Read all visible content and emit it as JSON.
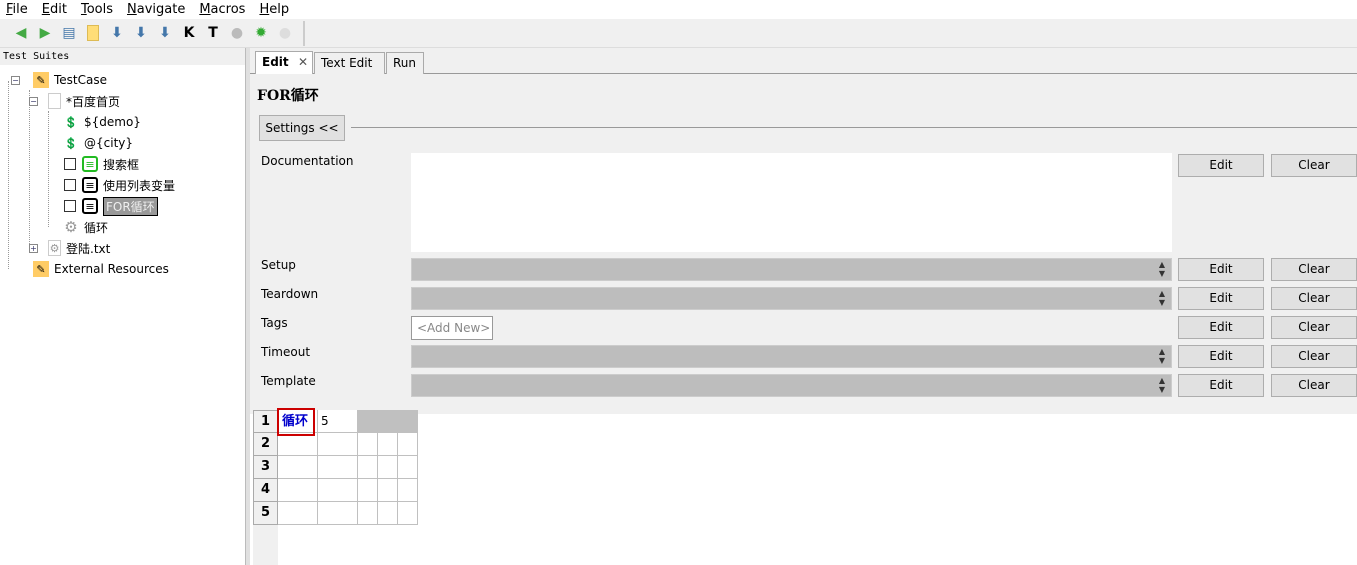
{
  "menu": [
    "File",
    "Edit",
    "Tools",
    "Navigate",
    "Macros",
    "Help"
  ],
  "toolbar": [
    "back-icon",
    "forward-icon",
    "open-icon",
    "folder-icon",
    "save-icon",
    "save-all-icon",
    "save-as-icon",
    "K",
    "T",
    "run-icon",
    "debug-icon",
    "stop-icon"
  ],
  "tree": {
    "header": "Test Suites",
    "nodes": [
      {
        "label": "TestCase",
        "icon": "suite-icon"
      },
      {
        "label": "*百度首页",
        "icon": "file-icon"
      },
      {
        "label": "${demo}",
        "icon": "variable-icon"
      },
      {
        "label": "@{city}",
        "icon": "variable-icon"
      },
      {
        "label": "搜索框",
        "icon": "testcase-icon"
      },
      {
        "label": "使用列表变量",
        "icon": "testcase-icon"
      },
      {
        "label": "FOR循环",
        "icon": "testcase-icon",
        "selected": true
      },
      {
        "label": "循环",
        "icon": "keyword-gear-icon"
      },
      {
        "label": "登陆.txt",
        "icon": "resource-file-icon"
      },
      {
        "label": "External Resources",
        "icon": "suite-icon"
      }
    ]
  },
  "tabs": [
    {
      "label": "Edit",
      "active": true
    },
    {
      "label": "Text Edit"
    },
    {
      "label": "Run"
    }
  ],
  "editor": {
    "title": "FOR循环",
    "settings_label": "Settings <<",
    "documentation": "Documentation",
    "setup": "Setup",
    "teardown": "Teardown",
    "tags": "Tags",
    "tags_placeholder": "<Add New>",
    "timeout": "Timeout",
    "template": "Template",
    "edit": "Edit",
    "clear": "Clear"
  },
  "grid": {
    "rows": [
      "1",
      "2",
      "3",
      "4",
      "5"
    ],
    "cells": [
      [
        "循环",
        "5"
      ]
    ]
  }
}
